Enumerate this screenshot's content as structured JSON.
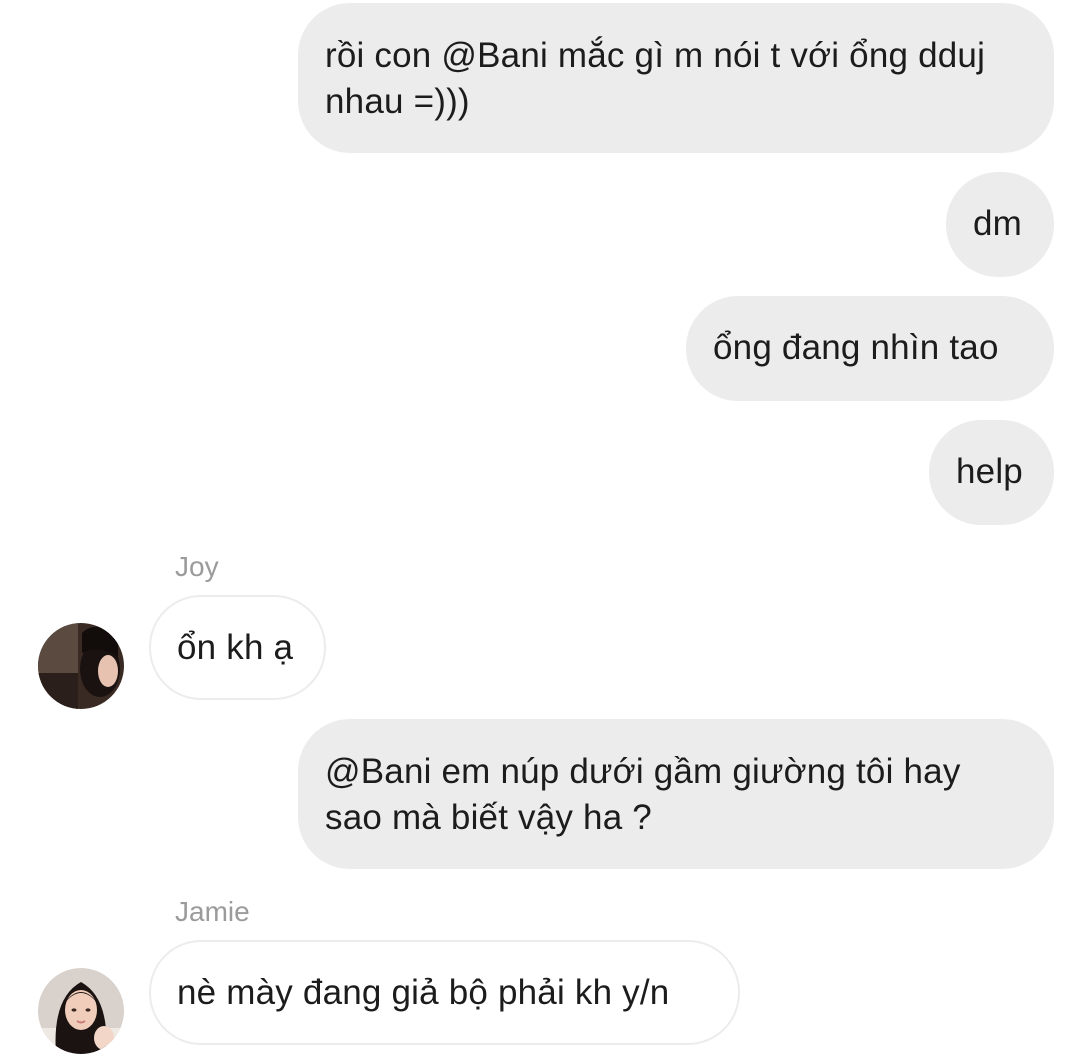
{
  "messages": [
    {
      "type": "outgoing",
      "text": "rồi con @Bani mắc gì m nói t với ổng dduj nhau =)))"
    },
    {
      "type": "outgoing",
      "text": "dm"
    },
    {
      "type": "outgoing",
      "text": "ổng đang nhìn tao"
    },
    {
      "type": "outgoing",
      "text": "help"
    },
    {
      "type": "incoming",
      "sender": "Joy",
      "avatar": "avatar-joy",
      "text": "ổn kh ạ"
    },
    {
      "type": "outgoing",
      "text": "@Bani em núp dưới gầm giường tôi hay sao mà biết vậy ha ?"
    },
    {
      "type": "incoming",
      "sender": "Jamie",
      "avatar": "avatar-jamie",
      "text": "nè mày đang giả bộ phải kh y/n"
    }
  ],
  "colors": {
    "outgoing_bubble": "#ececec",
    "incoming_border": "#ececec",
    "text": "#1c1c1c",
    "sender_name": "#9b9b9b",
    "background": "#ffffff"
  }
}
